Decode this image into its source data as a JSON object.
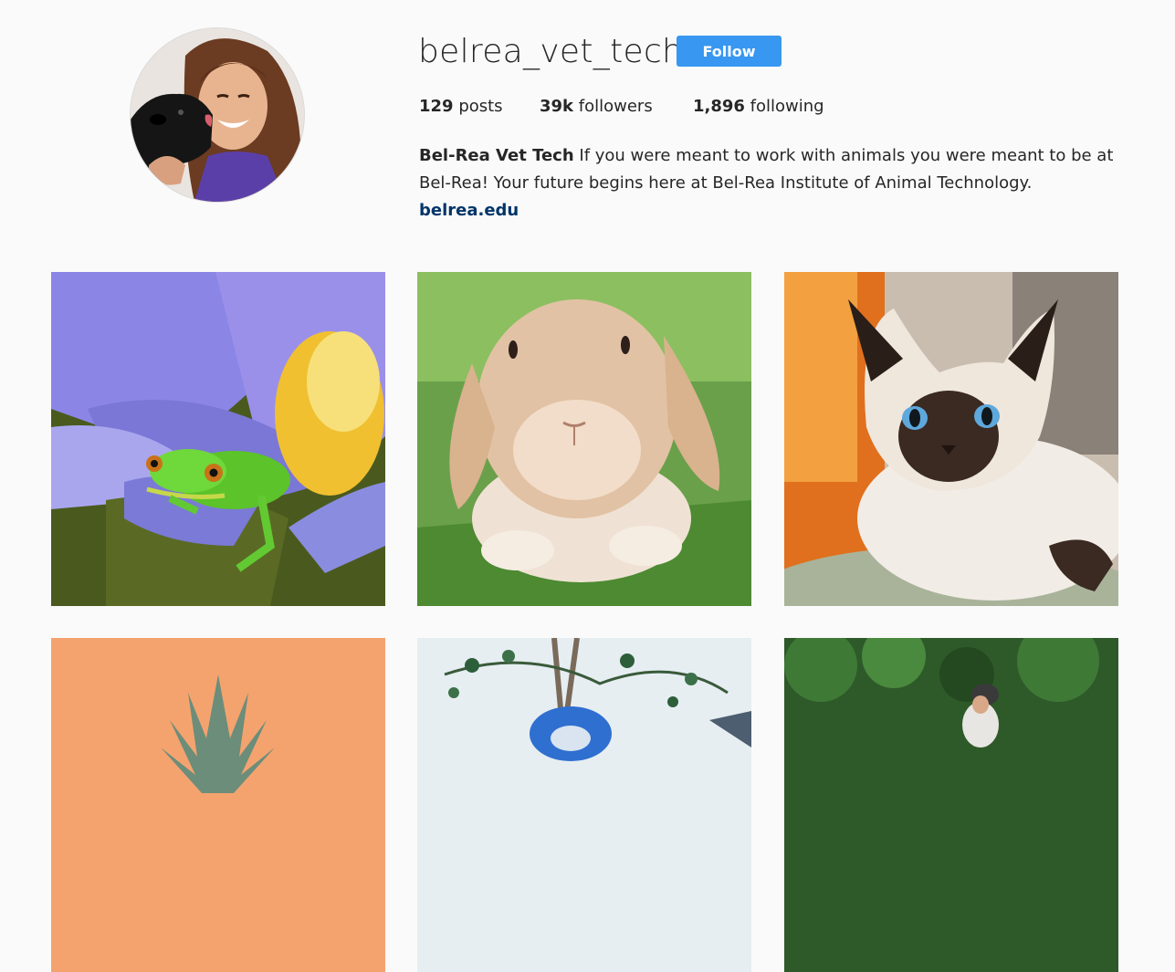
{
  "profile": {
    "username": "belrea_vet_tech",
    "follow_label": "Follow",
    "avatar_icon": "profile-photo-woman-with-dog"
  },
  "stats": {
    "posts_count": "129",
    "posts_label": "posts",
    "followers_count": "39k",
    "followers_label": "followers",
    "following_count": "1,896",
    "following_label": "following"
  },
  "bio": {
    "name": "Bel-Rea Vet Tech",
    "text": "If you were meant to work with animals you were meant to be at Bel-Rea! Your future begins here at Bel-Rea Institute of Animal Technology.",
    "link": "belrea.edu"
  },
  "colors": {
    "accent": "#3897f0",
    "link": "#003569",
    "background": "#fafafa"
  },
  "posts": [
    {
      "subject": "frog-on-purple-flower"
    },
    {
      "subject": "lop-eared-rabbit"
    },
    {
      "subject": "siamese-kitten"
    },
    {
      "subject": "pineapple-on-orange"
    },
    {
      "subject": "blue-bird-in-tree"
    },
    {
      "subject": "rider-in-forest"
    }
  ]
}
